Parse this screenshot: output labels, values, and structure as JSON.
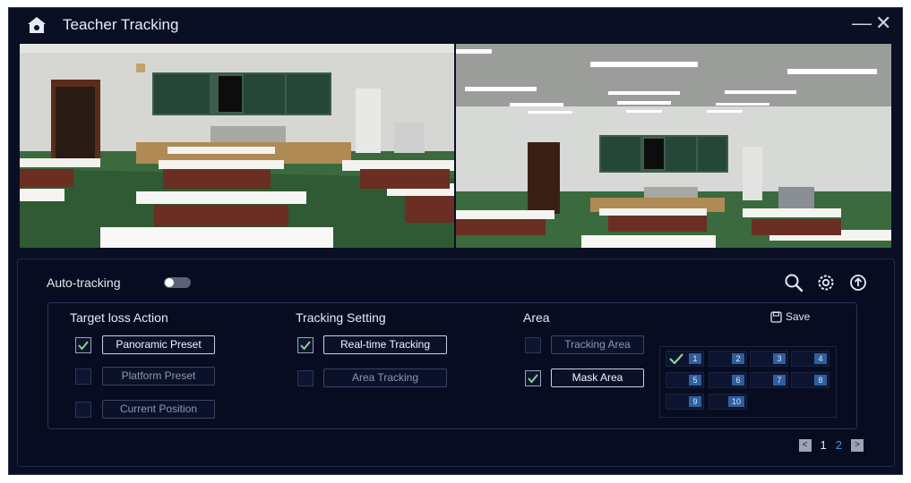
{
  "window": {
    "title": "Teacher Tracking",
    "minimize_glyph": "—",
    "close_glyph": "✕"
  },
  "panel": {
    "auto_tracking_label": "Auto-tracking",
    "auto_tracking_on": false,
    "icons": [
      "search-icon",
      "settings-icon",
      "upload-icon"
    ]
  },
  "target_loss": {
    "title": "Target loss Action",
    "options": [
      {
        "label": "Panoramic Preset",
        "checked": true
      },
      {
        "label": "Platform Preset",
        "checked": false
      },
      {
        "label": "Current Position",
        "checked": false
      }
    ]
  },
  "tracking_setting": {
    "title": "Tracking Setting",
    "options": [
      {
        "label": "Real-time Tracking",
        "checked": true
      },
      {
        "label": "Area Tracking",
        "checked": false
      }
    ]
  },
  "area": {
    "title": "Area",
    "save_label": "Save",
    "options": [
      {
        "label": "Tracking Area",
        "checked": false
      },
      {
        "label": "Mask Area",
        "checked": true
      }
    ],
    "cells": [
      "1",
      "2",
      "3",
      "4",
      "5",
      "6",
      "7",
      "8",
      "9",
      "10"
    ],
    "checked_cells": [
      "1"
    ]
  },
  "pager": {
    "prev_glyph": "<",
    "next_glyph": ">",
    "pages": [
      "1",
      "2"
    ],
    "active_page": "2"
  },
  "colors": {
    "background": "#0a0f24",
    "accent": "#4b8fe0",
    "check": "#8cd48a",
    "cell_badge": "#2f5f9e"
  }
}
